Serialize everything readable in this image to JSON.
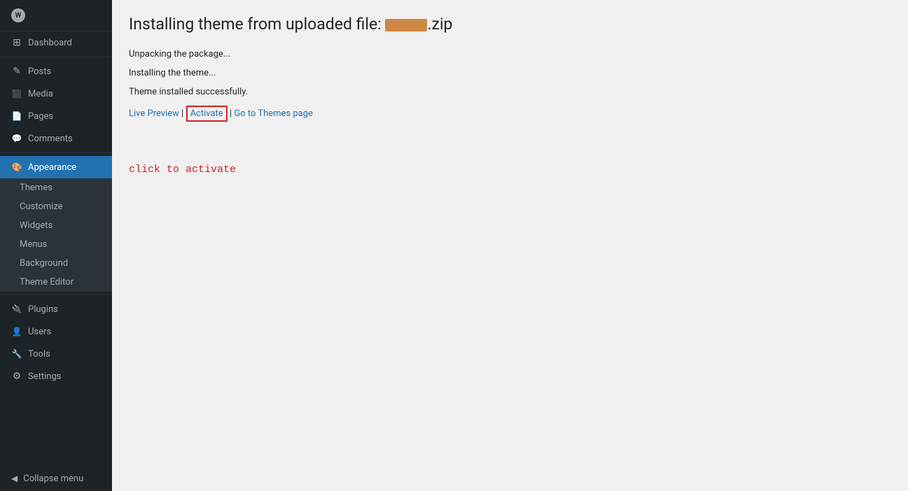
{
  "sidebar": {
    "logo_label": "W",
    "items": [
      {
        "id": "dashboard",
        "label": "Dashboard",
        "icon": "dashboard",
        "active": false
      },
      {
        "id": "posts",
        "label": "Posts",
        "icon": "posts",
        "active": false
      },
      {
        "id": "media",
        "label": "Media",
        "icon": "media",
        "active": false
      },
      {
        "id": "pages",
        "label": "Pages",
        "icon": "pages",
        "active": false
      },
      {
        "id": "comments",
        "label": "Comments",
        "icon": "comments",
        "active": false
      },
      {
        "id": "appearance",
        "label": "Appearance",
        "icon": "appearance",
        "active": true
      },
      {
        "id": "plugins",
        "label": "Plugins",
        "icon": "plugins",
        "active": false
      },
      {
        "id": "users",
        "label": "Users",
        "icon": "users",
        "active": false
      },
      {
        "id": "tools",
        "label": "Tools",
        "icon": "tools",
        "active": false
      },
      {
        "id": "settings",
        "label": "Settings",
        "icon": "settings",
        "active": false
      }
    ],
    "submenu_appearance": [
      {
        "id": "themes",
        "label": "Themes",
        "active": false
      },
      {
        "id": "customize",
        "label": "Customize",
        "active": false
      },
      {
        "id": "widgets",
        "label": "Widgets",
        "active": false
      },
      {
        "id": "menus",
        "label": "Menus",
        "active": false
      },
      {
        "id": "background",
        "label": "Background",
        "active": false
      },
      {
        "id": "theme-editor",
        "label": "Theme Editor",
        "active": false
      }
    ],
    "collapse_label": "Collapse menu"
  },
  "main": {
    "title_prefix": "Installing theme from uploaded file:",
    "filename_suffix": ".zip",
    "step1": "Unpacking the package...",
    "step2": "Installing the theme...",
    "step3": "Theme installed successfully.",
    "link_live_preview": "Live Preview",
    "link_separator1": " | ",
    "link_activate": "Activate",
    "link_separator2": " | ",
    "link_go_to_themes": "Go to Themes page",
    "annotation": "click to activate"
  }
}
